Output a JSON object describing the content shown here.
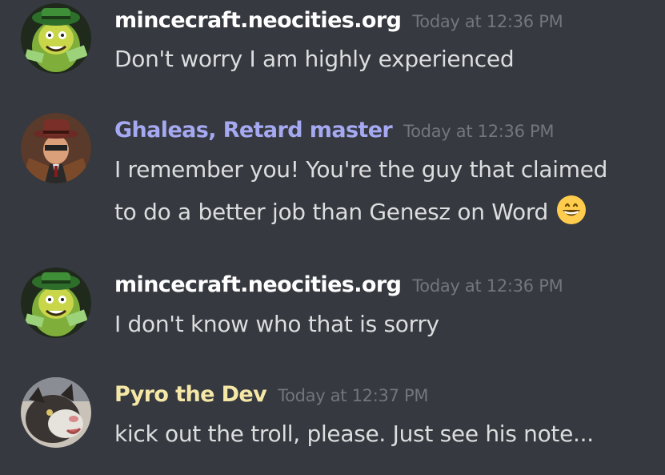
{
  "theme": {
    "background": "#36393f",
    "message_text_color": "#dcddde",
    "timestamp_color": "#72767d"
  },
  "messages": [
    {
      "author": "mincecraft.neocities.org",
      "author_color": "#ffffff",
      "avatar": "green-money-character-avatar",
      "timestamp": "Today at 12:36 PM",
      "lines": [
        "Don't worry I am highly experienced"
      ]
    },
    {
      "author": "Ghaleas, Retard master",
      "author_color": "#a5a9f1",
      "avatar": "hat-suit-character-avatar",
      "timestamp": "Today at 12:36 PM",
      "lines": [
        "I remember you! You're the guy that claimed",
        "to do a better job than Genesz on Word"
      ],
      "emoji": "grinning-face-emoji"
    },
    {
      "author": "mincecraft.neocities.org",
      "author_color": "#ffffff",
      "avatar": "green-money-character-avatar",
      "timestamp": "Today at 12:36 PM",
      "lines": [
        "I don't know who that is sorry"
      ]
    },
    {
      "author": "Pyro the Dev",
      "author_color": "#f5e8a7",
      "avatar": "cat-photo-avatar",
      "timestamp": "Today at 12:37 PM",
      "lines": [
        "kick out the troll, please. Just see his note..."
      ]
    }
  ]
}
